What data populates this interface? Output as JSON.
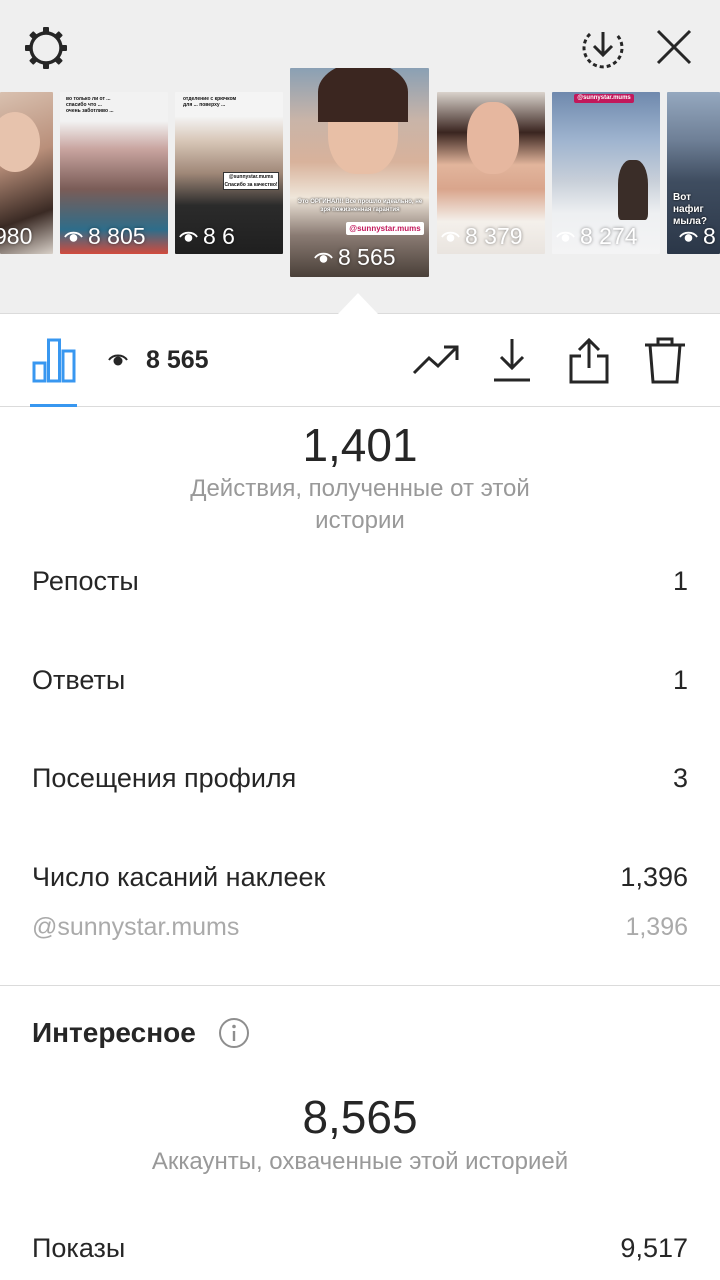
{
  "header": {
    "settings_icon": "gear-icon",
    "download_icon": "download-circle-icon",
    "close_icon": "close-icon"
  },
  "stories": [
    {
      "views": "980",
      "sticker_text": ""
    },
    {
      "views": "8 805"
    },
    {
      "views": "8 6",
      "sticker_text": "@sunnystar.mums",
      "sticker_sub": "Спасибо за качество!"
    },
    {
      "views": "8 565",
      "sticker_text": "@sunnystar.mums",
      "caption": "Это ОРГИНАЛ!! Все прошло идеально, не зря пожизненная гарантия"
    },
    {
      "views": "8 379"
    },
    {
      "views": "8 274",
      "tag": "@sunnystar.mums"
    },
    {
      "views": "8",
      "caption": "Вот нафиг мыла?"
    }
  ],
  "toolbar": {
    "insights_icon": "bar-chart-icon",
    "views_icon": "eye-icon",
    "views_count": "8 565",
    "promote_icon": "trending-up-icon",
    "download_icon": "download-icon",
    "share_icon": "share-icon",
    "delete_icon": "trash-icon"
  },
  "interactions": {
    "total": "1,401",
    "caption": "Действия, полученные от этой истории",
    "rows": [
      {
        "label": "Репосты",
        "value": "1"
      },
      {
        "label": "Ответы",
        "value": "1"
      },
      {
        "label": "Посещения профиля",
        "value": "3"
      },
      {
        "label": "Число касаний наклеек",
        "value": "1,396"
      }
    ],
    "sub_row": {
      "label": "@sunnystar.mums",
      "value": "1,396"
    }
  },
  "discovery": {
    "title": "Интересное",
    "info_icon": "info-icon",
    "total": "8,565",
    "caption": "Аккаунты, охваченные этой историей",
    "rows": [
      {
        "label": "Показы",
        "value": "9,517"
      }
    ]
  },
  "colors": {
    "accent": "#3897f0",
    "sticker": "#c2185b",
    "background_top": "#efefef"
  }
}
